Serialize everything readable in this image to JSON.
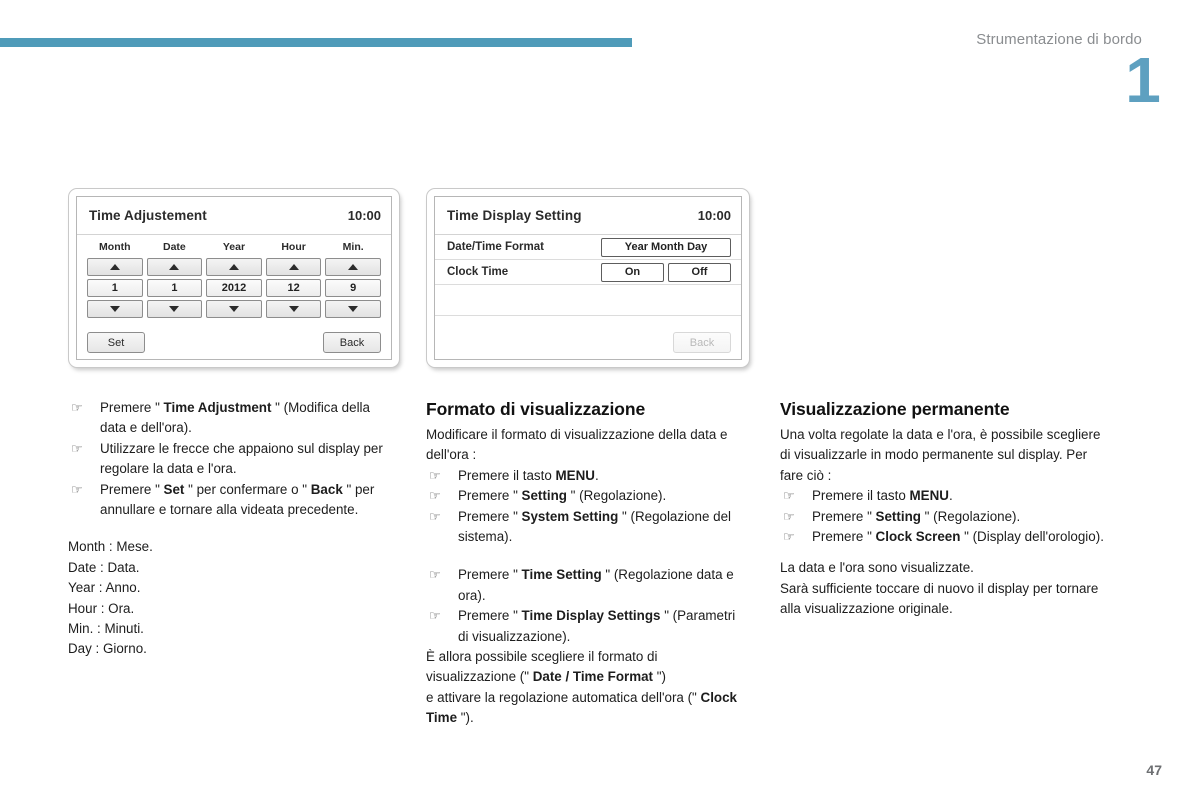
{
  "header": {
    "section_title": "Strumentazione di bordo",
    "chapter_number": "1",
    "page_number": "47",
    "rule_color": "#4f9bb9",
    "chapter_color": "#5ea0c0",
    "title_color": "#8a8d90"
  },
  "icons": {
    "hand_pointer": "☞",
    "arrow_up": "arrow-up-icon",
    "arrow_down": "arrow-down-icon"
  },
  "screens": {
    "time_adjustment": {
      "title": "Time Adjustement",
      "clock": "10:00",
      "columns": [
        {
          "label": "Month",
          "value": "1"
        },
        {
          "label": "Date",
          "value": "1"
        },
        {
          "label": "Year",
          "value": "2012"
        },
        {
          "label": "Hour",
          "value": "12"
        },
        {
          "label": "Min.",
          "value": "9"
        }
      ],
      "set_label": "Set",
      "back_label": "Back"
    },
    "time_display_setting": {
      "title": "Time Display Setting",
      "clock": "10:00",
      "rows": [
        {
          "label": "Date/Time Format",
          "options": [
            {
              "label": "Year Month Day",
              "width": "wide"
            }
          ]
        },
        {
          "label": "Clock Time",
          "options": [
            {
              "label": "On",
              "width": "half"
            },
            {
              "label": "Off",
              "width": "half"
            }
          ]
        }
      ],
      "back_label": "Back"
    }
  },
  "left_column": {
    "steps": [
      {
        "text_1": "Premere \" ",
        "bold_1": "Time Adjustment",
        "text_2": " \" (Modifica della data e dell'ora)."
      },
      {
        "text_1": "Utilizzare le frecce che appaiono sul display per regolare la data e l'ora.",
        "bold_1": "",
        "text_2": ""
      },
      {
        "text_1": "Premere \" ",
        "bold_1": "Set",
        "text_2": " \" per confermare o \" ",
        "bold_2": "Back",
        "text_3": " \" per annullare e tornare alla videata precedente."
      }
    ],
    "glossary": [
      "Month : Mese.",
      "Date : Data.",
      "Year : Anno.",
      "Hour : Ora.",
      "Min. : Minuti.",
      "Day : Giorno."
    ]
  },
  "middle_column": {
    "heading": "Formato di visualizzazione",
    "intro": "Modificare il formato di visualizzazione della data e dell'ora :",
    "steps": [
      {
        "pre": "Premere il tasto ",
        "bold": "MENU",
        "post": "."
      },
      {
        "pre": "Premere \" ",
        "bold": "Setting",
        "post": " \" (Regolazione)."
      },
      {
        "pre": "Premere \" ",
        "bold": "System Setting",
        "post": " \" (Regolazione del sistema)."
      },
      {
        "pre": "Premere \" ",
        "bold": "Time Setting",
        "post": " \" (Regolazione data e ora).",
        "spaced": true
      },
      {
        "pre": "Premere \" ",
        "bold": "Time Display Settings",
        "post": " \" (Parametri di visualizzazione)."
      }
    ],
    "outro_1": "È allora possibile scegliere il formato di visualizzazione (\" ",
    "outro_bold_1": "Date / Time Format",
    "outro_2": " \")",
    "outro_3": "e attivare la regolazione automatica dell'ora (\" ",
    "outro_bold_2": "Clock Time",
    "outro_4": " \")."
  },
  "right_column": {
    "heading": "Visualizzazione permanente",
    "intro": "Una volta regolate la data e l'ora, è possibile scegliere di visualizzarle in modo permanente sul display. Per fare ciò :",
    "steps": [
      {
        "pre": "Premere il tasto ",
        "bold": "MENU",
        "post": "."
      },
      {
        "pre": "Premere \" ",
        "bold": "Setting",
        "post": " \" (Regolazione)."
      },
      {
        "pre": "Premere \" ",
        "bold": "Clock Screen",
        "post": " \" (Display dell'orologio)."
      }
    ],
    "outro_1": "La data e l'ora sono visualizzate.",
    "outro_2": "Sarà sufficiente toccare di nuovo il display per tornare alla visualizzazione originale."
  }
}
